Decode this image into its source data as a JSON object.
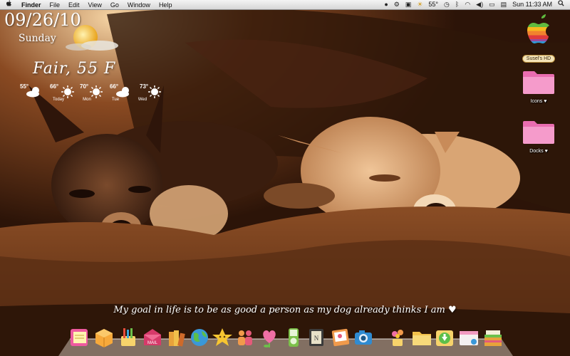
{
  "menubar": {
    "apple": "",
    "app_name": "Finder",
    "menus": [
      "File",
      "Edit",
      "View",
      "Go",
      "Window",
      "Help"
    ],
    "status_temp": "55°",
    "clock": "Sun 11:33 AM"
  },
  "widget": {
    "date": "09/26/10",
    "weekday": "Sunday",
    "condition": "Fair, 55 F",
    "forecast": [
      {
        "temp": "55°",
        "day": ""
      },
      {
        "temp": "66°",
        "day": "Today"
      },
      {
        "temp": "70°",
        "day": "Mon"
      },
      {
        "temp": "66°",
        "day": "Tue"
      },
      {
        "temp": "73°",
        "day": "Wed"
      }
    ]
  },
  "desktop": {
    "hd_label": "Susel's HD",
    "icons_folder": "Icons ♥",
    "docks_folder": "Docks ♥"
  },
  "quote": "My goal in life is to be as good a person as my dog already thinks I am ♥",
  "dock": {
    "items": [
      "notes",
      "package",
      "pencils",
      "mail",
      "books",
      "globe",
      "star",
      "people",
      "heart",
      "ipod",
      "notebook",
      "photo",
      "camera",
      "flowers",
      "folder",
      "download",
      "window",
      "cake"
    ]
  },
  "colors": {
    "folder_pink": "#f28fc4",
    "sepia_dark": "#3a1c0d",
    "sepia_light": "#d9a574"
  }
}
